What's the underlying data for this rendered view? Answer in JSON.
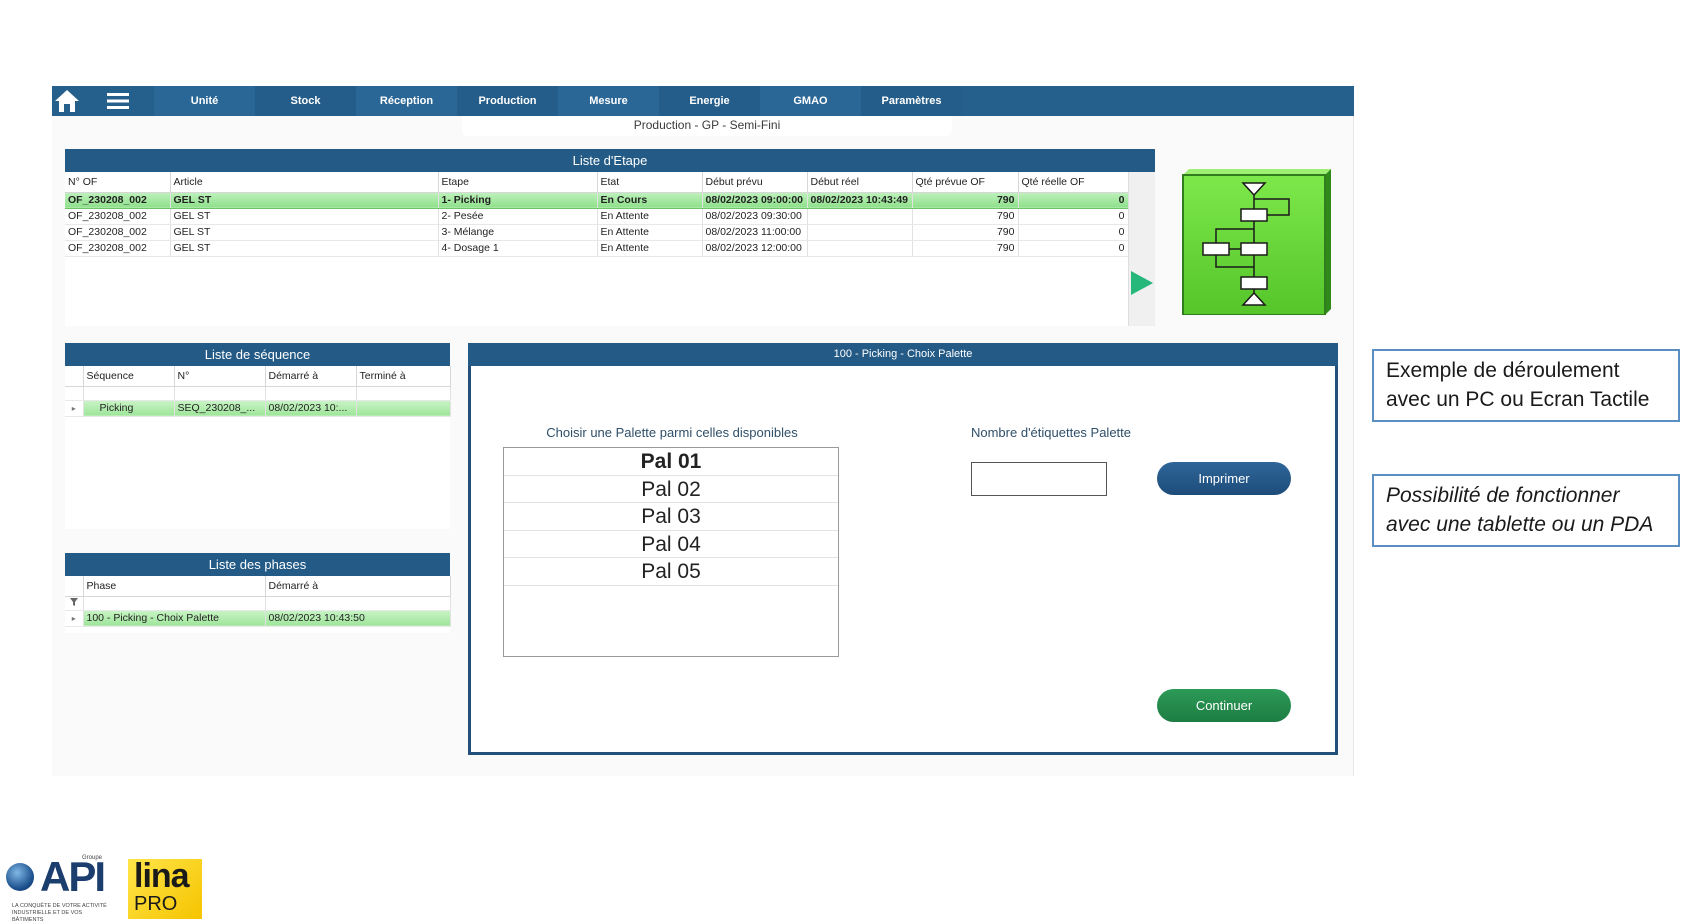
{
  "nav": {
    "items": [
      "Unité",
      "Stock",
      "Réception",
      "Production",
      "Mesure",
      "Energie",
      "GMAO",
      "Paramètres"
    ]
  },
  "page_title": "Production - GP - Semi-Fini",
  "etape": {
    "title": "Liste d'Etape",
    "columns": [
      "N° OF",
      "Article",
      "Etape",
      "Etat",
      "Début prévu",
      "Début réel",
      "Qté prévue OF",
      "Qté réelle OF"
    ],
    "rows": [
      [
        "OF_230208_002",
        "GEL ST",
        "1- Picking",
        "En Cours",
        "08/02/2023 09:00:00",
        "08/02/2023 10:43:49",
        "790",
        "0"
      ],
      [
        "OF_230208_002",
        "GEL ST",
        "2- Pesée",
        "En Attente",
        "08/02/2023 09:30:00",
        "",
        "790",
        "0"
      ],
      [
        "OF_230208_002",
        "GEL ST",
        "3- Mélange",
        "En Attente",
        "08/02/2023 11:00:00",
        "",
        "790",
        "0"
      ],
      [
        "OF_230208_002",
        "GEL ST",
        "4- Dosage 1",
        "En Attente",
        "08/02/2023 12:00:00",
        "",
        "790",
        "0"
      ]
    ]
  },
  "sequence": {
    "title": "Liste de séquence",
    "columns": [
      "Séquence",
      "N°",
      "Démarré à",
      "Terminé à"
    ],
    "rows": [
      [
        "Picking",
        "SEQ_230208_...",
        "08/02/2023 10:...",
        ""
      ]
    ]
  },
  "phases": {
    "title": "Liste des phases",
    "columns": [
      "Phase",
      "Démarré à"
    ],
    "rows": [
      [
        "100 - Picking - Choix Palette",
        "08/02/2023 10:43:50"
      ]
    ]
  },
  "dialog": {
    "title": "100 - Picking - Choix Palette",
    "choose_label": "Choisir une Palette parmi celles disponibles",
    "palettes": [
      "Pal 01",
      "Pal 02",
      "Pal 03",
      "Pal 04",
      "Pal 05"
    ],
    "selected_palette": "Pal 01",
    "nb_label": "Nombre d'étiquettes Palette",
    "nb_value": "",
    "print_label": "Imprimer",
    "continue_label": "Continuer"
  },
  "notes": {
    "note1": "Exemple de déroulement avec un PC ou Ecran Tactile",
    "note2": "Possibilité de fonctionner avec une tablette ou un PDA"
  },
  "logos": {
    "api": "API",
    "api_groupe": "Groupe",
    "api_tagline": "LA CONQUÊTE DE VOTRE ACTIVITÉ INDUSTRIELLE ET DE VOS BÂTIMENTS",
    "lina": "lina",
    "lina_pro": "PRO"
  },
  "colors": {
    "nav_bg": "#255f8c",
    "header_bg": "#235a86",
    "active_row": "#9fe59b",
    "print_button": "#1e4c7a",
    "continue_button": "#1d7d43",
    "flow_icon": "#6fd83a",
    "play_arrow": "#25b87a"
  },
  "icons": {
    "home": "home-icon",
    "menu": "hamburger-menu-icon",
    "flow": "flowchart-icon",
    "play": "play-arrow-icon"
  }
}
